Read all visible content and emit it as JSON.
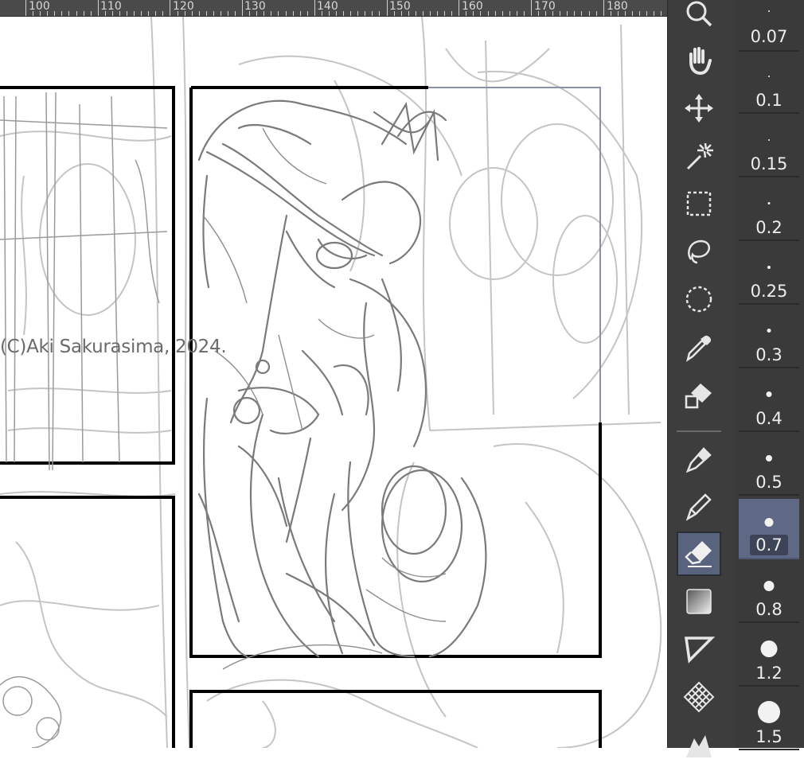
{
  "ruler": {
    "labels": [
      "100",
      "110",
      "120",
      "130",
      "140",
      "150",
      "160",
      "170",
      "180"
    ]
  },
  "canvas": {
    "copyright": "(C)Aki Sakurasima, 2024."
  },
  "tools": [
    {
      "icon": "zoom-icon",
      "active": false
    },
    {
      "icon": "hand-icon",
      "active": false
    },
    {
      "icon": "move-icon",
      "active": false
    },
    {
      "icon": "magic-wand-icon",
      "active": false
    },
    {
      "icon": "rect-select-icon",
      "active": false
    },
    {
      "icon": "lasso-icon",
      "active": false
    },
    {
      "icon": "ellipse-select-icon",
      "active": false
    },
    {
      "icon": "eyedropper-icon",
      "active": false
    },
    {
      "icon": "fill-icon",
      "active": false
    },
    {
      "icon": "marker-icon",
      "active": false
    },
    {
      "icon": "pen-icon",
      "active": false
    },
    {
      "icon": "eraser-icon",
      "active": true
    },
    {
      "icon": "gradient-icon",
      "active": false
    },
    {
      "icon": "frame-border-icon",
      "active": false
    },
    {
      "icon": "pattern-icon",
      "active": false
    },
    {
      "icon": "mountain-icon",
      "active": false
    }
  ],
  "brush_sizes": [
    {
      "value": "0.07",
      "active": false
    },
    {
      "value": "0.1",
      "active": false
    },
    {
      "value": "0.15",
      "active": false
    },
    {
      "value": "0.2",
      "active": false
    },
    {
      "value": "0.25",
      "active": false
    },
    {
      "value": "0.3",
      "active": false
    },
    {
      "value": "0.4",
      "active": false
    },
    {
      "value": "0.5",
      "active": false
    },
    {
      "value": "0.7",
      "active": true
    },
    {
      "value": "0.8",
      "active": false
    },
    {
      "value": "1.2",
      "active": false
    },
    {
      "value": "1.5",
      "active": false
    }
  ],
  "colors": {
    "panel_bg": "#3d3d3d",
    "active_highlight": "#5f6986",
    "sketch_gray": "#8c8c8c",
    "border": "#000000"
  }
}
